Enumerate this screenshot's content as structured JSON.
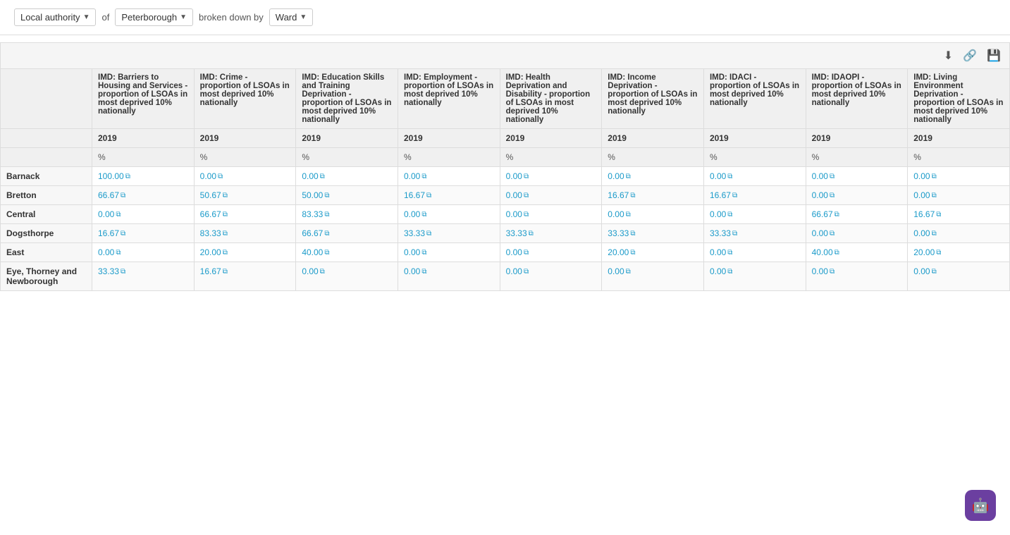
{
  "topbar": {
    "filter1_label": "Local authority",
    "of_text": "of",
    "filter2_label": "Peterborough",
    "broken_down_by_text": "broken down by",
    "filter3_label": "Ward"
  },
  "toolbar": {
    "download_title": "Download",
    "link_title": "Copy link",
    "save_title": "Save"
  },
  "table": {
    "columns": [
      {
        "id": "barriers",
        "header": "IMD: Barriers to Housing and Services - proportion of LSOAs in most deprived 10% nationally",
        "year": "2019",
        "unit": "%"
      },
      {
        "id": "crime",
        "header": "IMD: Crime - proportion of LSOAs in most deprived 10% nationally",
        "year": "2019",
        "unit": "%"
      },
      {
        "id": "education",
        "header": "IMD: Education Skills and Training Deprivation - proportion of LSOAs in most deprived 10% nationally",
        "year": "2019",
        "unit": "%"
      },
      {
        "id": "employment",
        "header": "IMD: Employment - proportion of LSOAs in most deprived 10% nationally",
        "year": "2019",
        "unit": "%"
      },
      {
        "id": "health",
        "header": "IMD: Health Deprivation and Disability - proportion of LSOAs in most deprived 10% nationally",
        "year": "2019",
        "unit": "%"
      },
      {
        "id": "income",
        "header": "IMD: Income Deprivation - proportion of LSOAs in most deprived 10% nationally",
        "year": "2019",
        "unit": "%"
      },
      {
        "id": "idaci",
        "header": "IMD: IDACI - proportion of LSOAs in most deprived 10% nationally",
        "year": "2019",
        "unit": "%"
      },
      {
        "id": "idaopi",
        "header": "IMD: IDAOPI - proportion of LSOAs in most deprived 10% nationally",
        "year": "2019",
        "unit": "%"
      },
      {
        "id": "living",
        "header": "IMD: Living Environment Deprivation - proportion of LSOAs in most deprived 10% nationally",
        "year": "2019",
        "unit": "%"
      }
    ],
    "rows": [
      {
        "name": "Barnack",
        "values": [
          "100.00",
          "0.00",
          "0.00",
          "0.00",
          "0.00",
          "0.00",
          "0.00",
          "0.00",
          "0.00"
        ]
      },
      {
        "name": "Bretton",
        "values": [
          "66.67",
          "50.67",
          "50.00",
          "16.67",
          "0.00",
          "16.67",
          "16.67",
          "0.00",
          "0.00"
        ]
      },
      {
        "name": "Central",
        "values": [
          "0.00",
          "66.67",
          "83.33",
          "0.00",
          "0.00",
          "0.00",
          "0.00",
          "66.67",
          "16.67"
        ]
      },
      {
        "name": "Dogsthorpe",
        "values": [
          "16.67",
          "83.33",
          "66.67",
          "33.33",
          "33.33",
          "33.33",
          "33.33",
          "0.00",
          "0.00"
        ]
      },
      {
        "name": "East",
        "values": [
          "0.00",
          "20.00",
          "40.00",
          "0.00",
          "0.00",
          "20.00",
          "0.00",
          "40.00",
          "20.00"
        ]
      },
      {
        "name": "Eye, Thorney and Newborough",
        "values": [
          "33.33",
          "16.67",
          "0.00",
          "0.00",
          "0.00",
          "0.00",
          "0.00",
          "0.00",
          "0.00"
        ]
      }
    ]
  },
  "chat_widget": {
    "icon": "💬"
  }
}
